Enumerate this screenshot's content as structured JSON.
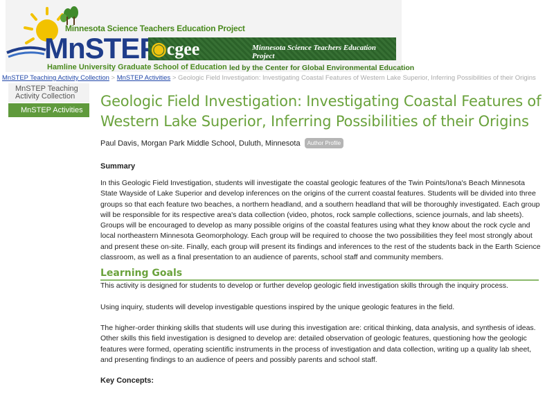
{
  "header": {
    "project_title": "Minnesota Science Teachers Education Project",
    "logo_text": "MnSTEP",
    "university": "Hamline University Graduate School of Education",
    "cgee_logo": "cgee",
    "cgee_tagline": "Minnesota Science Teachers Education Project",
    "led_by": "led by the Center for Global Environmental Education",
    "brand_green": "#6aa23c",
    "brand_blue": "#1f3d8a"
  },
  "breadcrumb": {
    "items": [
      "MnSTEP Teaching Activity Collection",
      "MnSTEP Activities"
    ],
    "separator": ">",
    "current": "Geologic Field Investigation: Investigating Coastal Features of Western Lake Superior, Inferring Possibilities of their Origins"
  },
  "sidebar": {
    "link_line1": "MnSTEP Teaching",
    "link_line2": "Activity Collection",
    "active": "MnSTEP Activities"
  },
  "main": {
    "title": "Geologic Field Investigation: Investigating Coastal Features of Western Lake Superior, Inferring Possibilities of their Origins",
    "author": "Paul Davis, Morgan Park Middle School, Duluth, Minnesota",
    "author_badge": "Author Profile",
    "summary_heading": "Summary",
    "summary_text": "In this Geologic Field Investigation, students will investigate the coastal geologic features of the Twin Points/Iona's Beach Minnesota State Wayside of Lake Superior and develop inferences on the origins of the current coastal features. Students will be divided into three groups so that each feature two beaches, a northern headland, and a southern headland that will be thoroughly investigated. Each group will be responsible for its respective area's data collection (video, photos, rock sample collections, science journals, and lab sheets). Groups will be encouraged to develop as many possible origins of the coastal features using what they know about the rock cycle and local northeastern Minnesota Geomorphology. Each group will be required to choose the two possibilities they feel most strongly about and present these on-site. Finally, each group will present its findings and inferences to the rest of the students back in the Earth Science classroom, as well as a final presentation to an audience of parents, school staff and community members.",
    "learning_goals_heading": "Learning Goals",
    "lg_p1": "This activity is designed for students to develop or further develop geologic field investigation skills through the inquiry process.",
    "lg_p2": "Using inquiry, students will develop investigable questions inspired by the unique geologic features in the field.",
    "lg_p3": "The higher-order thinking skills that students will use during this investigation are: critical thinking, data analysis, and synthesis of ideas.",
    "lg_p4": "Other skills this field investigation is designed to develop are: detailed observation of geologic features, questioning how the geologic features were formed, operating scientific instruments in the process of investigation and data collection, writing up a quality lab sheet, and presenting findings to an audience of peers and possibly parents and school staff.",
    "key_concepts": "Key Concepts:"
  }
}
